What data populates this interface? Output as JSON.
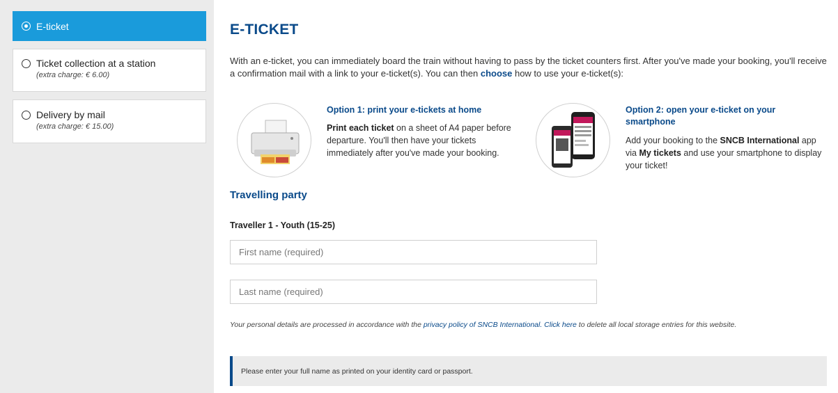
{
  "delivery_options": [
    {
      "label": "E-ticket",
      "sub": "",
      "selected": true
    },
    {
      "label": "Ticket collection at a station",
      "sub": "(extra charge: € 6.00)",
      "selected": false
    },
    {
      "label": "Delivery by mail",
      "sub": "(extra charge: € 15.00)",
      "selected": false
    }
  ],
  "main": {
    "title": "E-TICKET",
    "intro_before": "With an e-ticket, you can immediately board the train without having to pass by the ticket counters first. After you've made your booking, you'll receive a confirmation mail with a link to your e-ticket(s). You can then ",
    "intro_bold": "choose",
    "intro_after": " how to use your e-ticket(s):",
    "option1": {
      "title": "Option 1: print your e-tickets at home",
      "bold": "Print each ticket",
      "text": " on a sheet of A4 paper before departure. You'll then have your tickets immediately after you've made your booking."
    },
    "option2": {
      "title": "Option 2: open your e-ticket on your smartphone",
      "text_a": "Add your booking to the ",
      "bold_a": "SNCB International",
      "text_b": " app via ",
      "bold_b": "My tickets",
      "text_c": " and use your smartphone to display your ticket!"
    },
    "party_heading": "Travelling party",
    "traveller_label": "Traveller 1 - Youth (15-25)",
    "first_name_placeholder": "First name (required)",
    "last_name_placeholder": "Last name (required)",
    "privacy_before": "Your personal details are processed in accordance with the ",
    "privacy_link1": "privacy policy of SNCB International.",
    "privacy_link2": " Click here",
    "privacy_after": " to delete all local storage entries for this website.",
    "notice": "Please enter your full name as printed on your identity card or passport."
  },
  "colors": {
    "accent": "#1a9bdb",
    "heading": "#0a4a8a"
  },
  "icons": {
    "option1": "printer-icon",
    "option2": "smartphone-icon"
  }
}
